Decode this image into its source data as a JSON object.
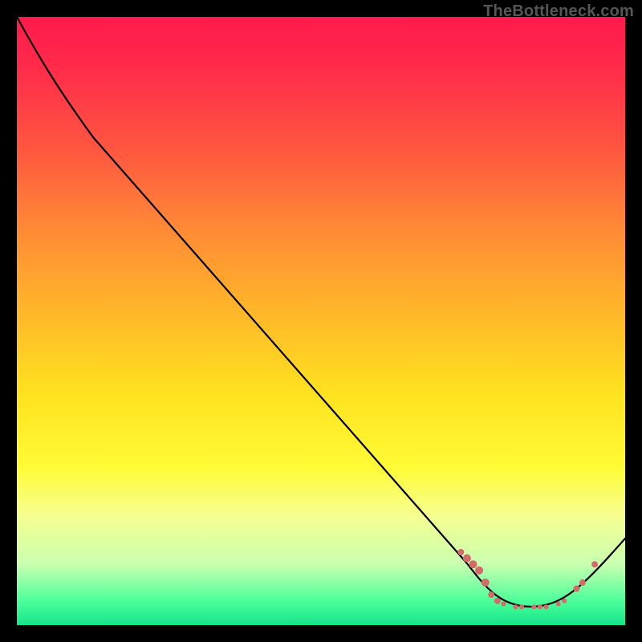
{
  "watermark": "TheBottleneck.com",
  "colors": {
    "gradient_top": "#ff1a4d",
    "gradient_mid": "#ffe21f",
    "gradient_bottom": "#15e58a",
    "curve": "#000000",
    "points": "#d46a6a",
    "background": "#000000",
    "watermark": "#565656"
  },
  "chart_data": {
    "type": "line",
    "title": "",
    "xlabel": "",
    "ylabel": "",
    "xlim": [
      0,
      100
    ],
    "ylim": [
      0,
      100
    ],
    "grid": false,
    "legend": false,
    "series": [
      {
        "name": "curve",
        "x": [
          0,
          5,
          10,
          15,
          20,
          25,
          30,
          35,
          40,
          45,
          50,
          55,
          60,
          65,
          70,
          73,
          76,
          80,
          84,
          88,
          92,
          96,
          100
        ],
        "y": [
          100,
          93,
          87,
          81,
          74,
          67,
          60,
          53,
          46,
          39,
          32,
          25,
          18,
          11,
          7,
          5,
          3.5,
          3,
          3,
          3.5,
          6,
          10,
          14
        ]
      }
    ],
    "scatter_points": {
      "name": "optimal-region-markers",
      "points": [
        {
          "x": 73,
          "y": 12,
          "r": 4
        },
        {
          "x": 74,
          "y": 11,
          "r": 5
        },
        {
          "x": 75,
          "y": 10,
          "r": 5
        },
        {
          "x": 76,
          "y": 9,
          "r": 5
        },
        {
          "x": 77,
          "y": 7,
          "r": 5
        },
        {
          "x": 78,
          "y": 5,
          "r": 4
        },
        {
          "x": 79,
          "y": 4,
          "r": 4
        },
        {
          "x": 80,
          "y": 3.5,
          "r": 3
        },
        {
          "x": 82,
          "y": 3,
          "r": 3
        },
        {
          "x": 83,
          "y": 3,
          "r": 3
        },
        {
          "x": 85,
          "y": 3,
          "r": 3
        },
        {
          "x": 86,
          "y": 3,
          "r": 3
        },
        {
          "x": 87,
          "y": 3,
          "r": 3
        },
        {
          "x": 89,
          "y": 3.5,
          "r": 3
        },
        {
          "x": 90,
          "y": 4,
          "r": 3
        },
        {
          "x": 92,
          "y": 6,
          "r": 4
        },
        {
          "x": 93,
          "y": 7,
          "r": 4
        },
        {
          "x": 95,
          "y": 10,
          "r": 4
        }
      ]
    }
  }
}
